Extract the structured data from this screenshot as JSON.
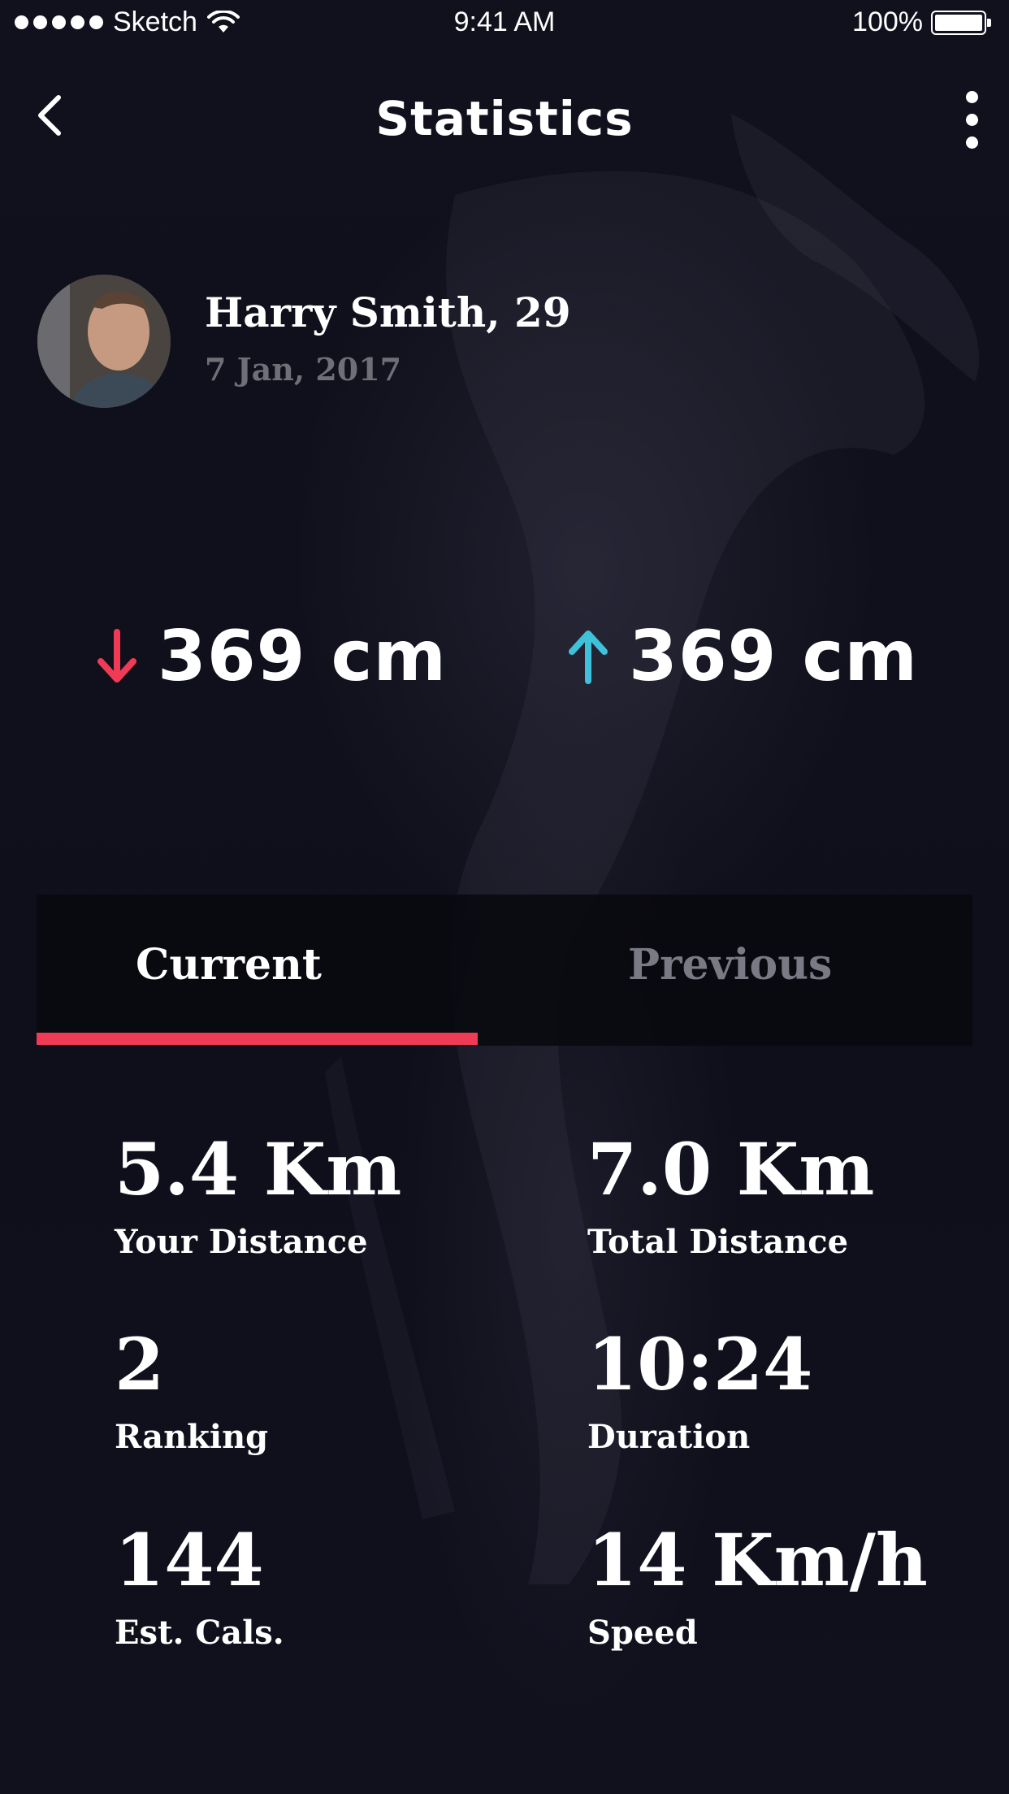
{
  "status_bar": {
    "carrier": "Sketch",
    "time": "9:41 AM",
    "battery": "100%"
  },
  "nav": {
    "title": "Statistics",
    "back_icon": "chevron-left-icon",
    "more_icon": "more-vertical-icon"
  },
  "profile": {
    "name": "Harry Smith, 29",
    "date": "7 Jan, 2017"
  },
  "measures": [
    {
      "value": "369 cm",
      "direction": "down",
      "color": "#ef3b55"
    },
    {
      "value": "369 cm",
      "direction": "up",
      "color": "#3fc1d9"
    }
  ],
  "tabs": {
    "current": "Current",
    "previous": "Previous",
    "active": "current",
    "accent_color": "#ef3b55"
  },
  "stats": [
    {
      "value": "5.4 Km",
      "label": "Your Distance"
    },
    {
      "value": "7.0 Km",
      "label": "Total Distance"
    },
    {
      "value": "2",
      "label": "Ranking"
    },
    {
      "value": "10:24",
      "label": "Duration"
    },
    {
      "value": "144",
      "label": "Est. Cals."
    },
    {
      "value": "14 Km/h",
      "label": "Speed"
    }
  ]
}
